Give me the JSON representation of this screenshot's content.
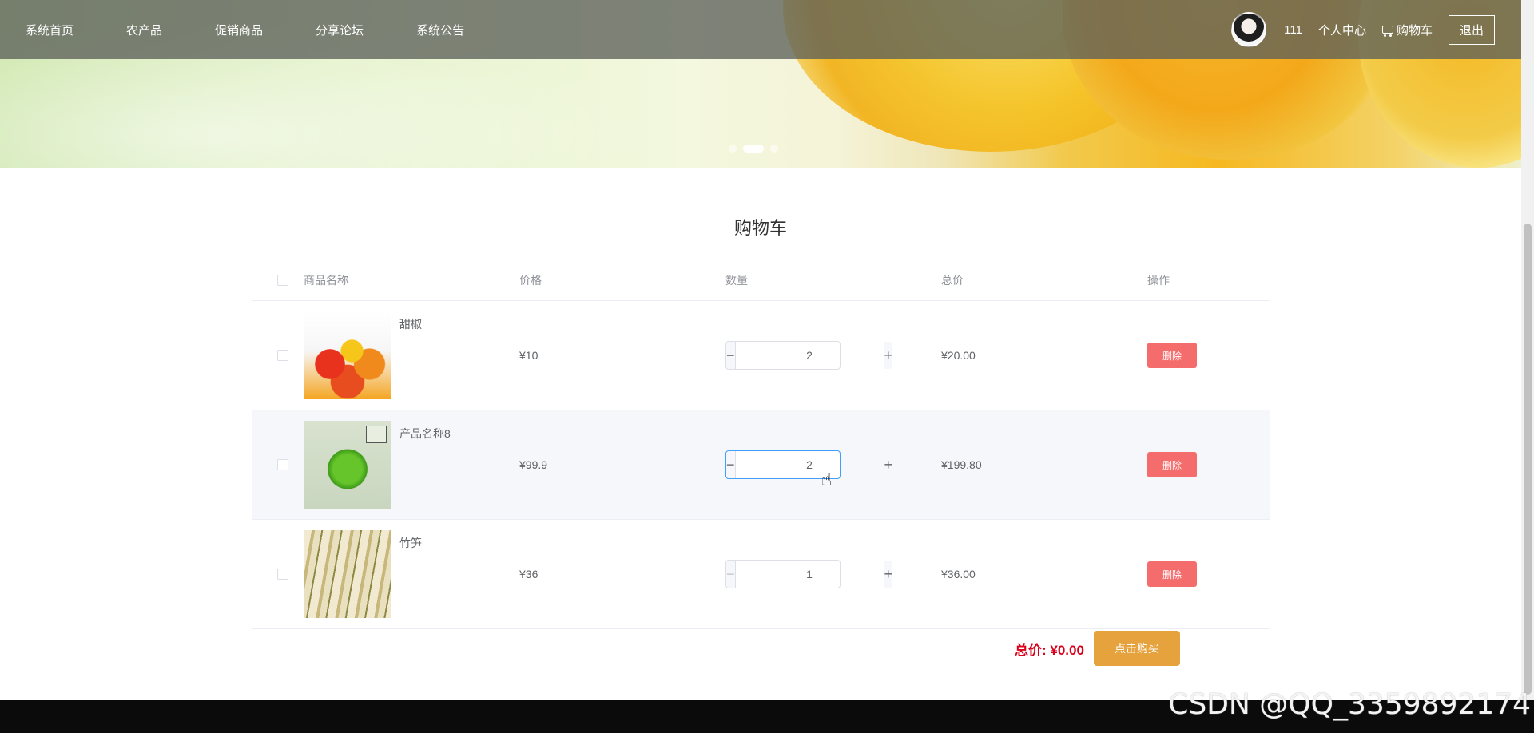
{
  "nav": {
    "items": [
      "系统首页",
      "农产品",
      "促销商品",
      "分享论坛",
      "系统公告"
    ],
    "username": "111",
    "personal_center": "个人中心",
    "cart": "购物车",
    "logout": "退出"
  },
  "banner": {
    "active_slide": 2,
    "slide_count": 3
  },
  "cart": {
    "title": "购物车",
    "headers": {
      "name": "商品名称",
      "price": "价格",
      "qty": "数量",
      "total": "总价",
      "op": "操作"
    },
    "rows": [
      {
        "name": "甜椒",
        "price": "¥10",
        "qty": "2",
        "total": "¥20.00",
        "delete": "删除"
      },
      {
        "name": "产品名称8",
        "price": "¥99.9",
        "qty": "2",
        "total": "¥199.80",
        "delete": "删除"
      },
      {
        "name": "竹笋",
        "price": "¥36",
        "qty": "1",
        "total": "¥36.00",
        "delete": "删除"
      }
    ],
    "minus": "−",
    "plus": "+",
    "summary_label": "总价: ¥0.00",
    "buy": "点击购买"
  },
  "watermark": "CSDN @QQ_3359892174"
}
